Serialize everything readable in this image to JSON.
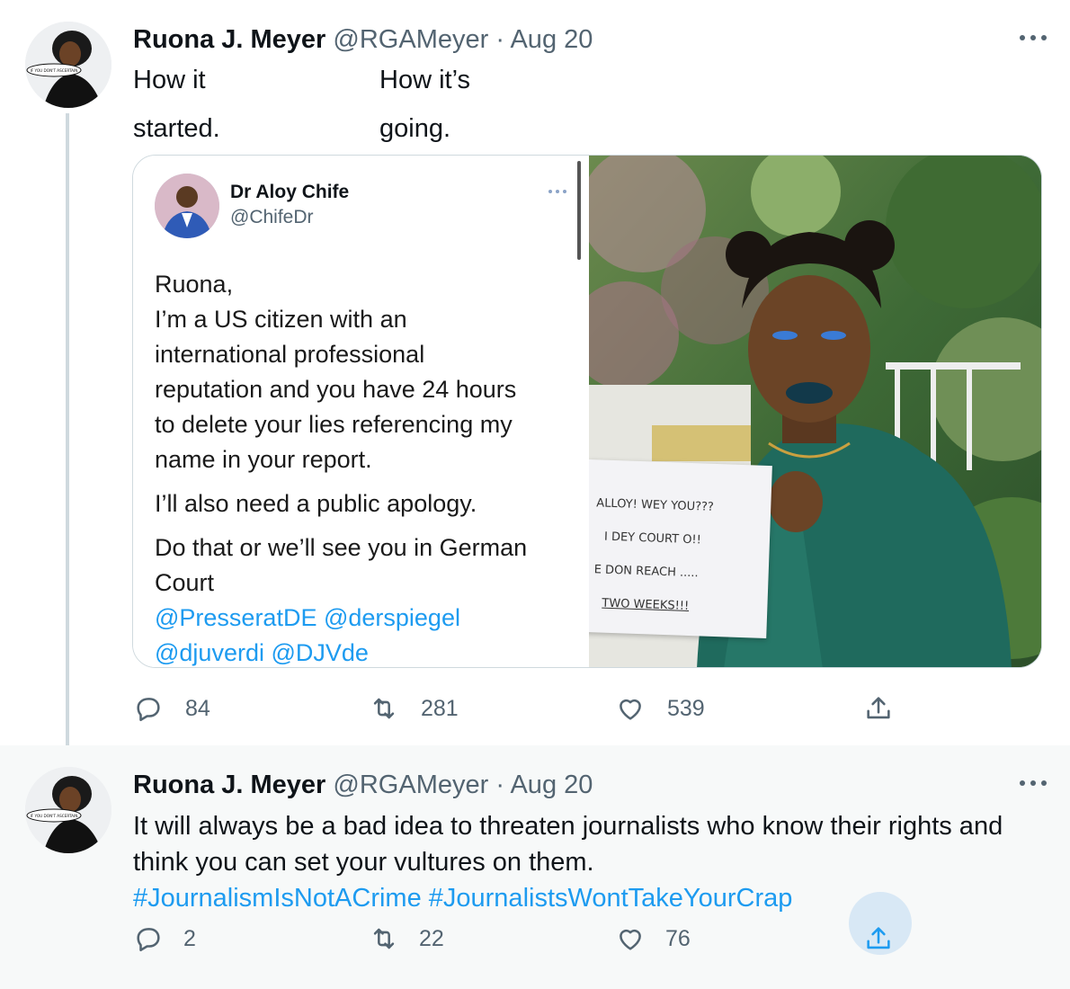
{
  "tweet1": {
    "name": "Ruona J. Meyer",
    "handle": "@RGAMeyer",
    "separator": "·",
    "date": "Aug 20",
    "text_left": [
      "How it",
      "started."
    ],
    "text_right": [
      "How it’s",
      "going."
    ],
    "embedded_tweet": {
      "name": "Dr Aloy Chife",
      "handle": "@ChifeDr",
      "lines": [
        "Ruona,",
        "I’m a US citizen with an",
        "international professional",
        "reputation and you have 24 hours",
        "to delete your lies referencing my",
        "name in your report."
      ],
      "line_apology": "I’ll also need a public apology.",
      "line_court_1": "Do that or we’ll see you in German",
      "line_court_2": "Court",
      "mentions_1": "@PresseratDE @derspiegel",
      "mentions_2": "@djuverdi @DJVde"
    },
    "sign_lines": [
      "ALLOY! WEY YOU???",
      "I DEY COURT O!!",
      "E DON REACH .....",
      "TWO WEEKS!!!"
    ],
    "avatar_badge": "IF YOU DON'T ASCERTAIN",
    "replies": "84",
    "retweets": "281",
    "likes": "539"
  },
  "tweet2": {
    "name": "Ruona J. Meyer",
    "handle": "@RGAMeyer",
    "separator": "·",
    "date": "Aug 20",
    "text_line1": "It will always be a bad idea to threaten journalists who know their rights and",
    "text_line2": "think you can set your vultures on them.",
    "hashtag1": "#JournalismIsNotACrime",
    "hashtag2": "#JournalistsWontTakeYourCrap",
    "avatar_badge": "IF YOU DON'T ASCERTAIN",
    "replies": "2",
    "retweets": "22",
    "likes": "76"
  },
  "colors": {
    "link": "#1d9bf0",
    "secondary_text": "#536471",
    "thread_line": "#cfd9de",
    "selected_bg": "#f7f9f9"
  },
  "icons": [
    "reply-icon",
    "retweet-icon",
    "like-icon",
    "share-icon",
    "more-icon"
  ]
}
